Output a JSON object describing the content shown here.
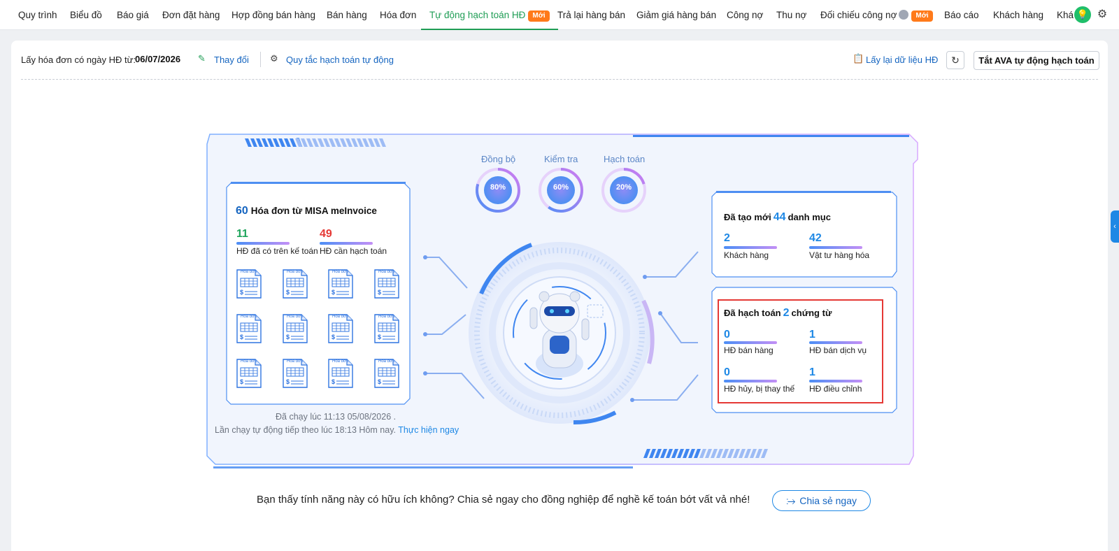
{
  "nav": {
    "items": [
      {
        "label": "Quy trình"
      },
      {
        "label": "Biểu đồ"
      },
      {
        "label": "Báo giá"
      },
      {
        "label": "Đơn đặt hàng"
      },
      {
        "label": "Hợp đồng bán hàng"
      },
      {
        "label": "Bán hàng"
      },
      {
        "label": "Hóa đơn"
      },
      {
        "label": "Tự động hạch toán HĐ",
        "badge": "Mới",
        "active": true
      },
      {
        "label": "Trả lại hàng bán"
      },
      {
        "label": "Giảm giá hàng bán"
      },
      {
        "label": "Công nợ"
      },
      {
        "label": "Thu nợ"
      },
      {
        "label": "Đối chiếu công nợ",
        "badge": "Mới"
      },
      {
        "label": "Báo cáo"
      },
      {
        "label": "Khách hàng"
      },
      {
        "label": "Khá"
      }
    ],
    "accent": "#1f9d55",
    "badge_color": "#ff7a1a"
  },
  "toolbar": {
    "date_label": "Lấy hóa đơn có ngày HĐ từ:",
    "date_value": "06/07/2026",
    "change_label": "Thay đổi",
    "rules_label": "Quy tắc hạch toán tự động",
    "reload_label": "Lấy lại dữ liệu HĐ",
    "toggle_ava_label": "Tắt AVA tự động hạch toán"
  },
  "stages": [
    {
      "label": "Đồng bộ",
      "percent_label": "80%",
      "percent": 80
    },
    {
      "label": "Kiểm tra",
      "percent_label": "60%",
      "percent": 60
    },
    {
      "label": "Hạch toán",
      "percent_label": "20%",
      "percent": 20
    }
  ],
  "invoices": {
    "total": "60",
    "title": "Hóa đơn từ MISA meInvoice",
    "in_books_count": "11",
    "in_books_label": "HĐ đã có trên kế toán",
    "to_post_count": "49",
    "to_post_label": "HĐ cần hạch toán",
    "doc_icon_label": "Hóa đơn"
  },
  "created": {
    "prefix": "Đã tạo mới",
    "count": "44",
    "suffix": "danh mục",
    "customers_count": "2",
    "customers_label": "Khách hàng",
    "items_count": "42",
    "items_label": "Vật tư hàng hóa"
  },
  "posted": {
    "prefix": "Đã hạch toán",
    "count": "2",
    "suffix": "chứng từ",
    "sales_count": "0",
    "sales_label": "HĐ bán hàng",
    "service_count": "1",
    "service_label": "HĐ bán dịch vụ",
    "cancelled_count": "0",
    "cancelled_label": "HĐ hủy, bị thay thế",
    "adjust_count": "1",
    "adjust_label": "HĐ điều chỉnh"
  },
  "run": {
    "last_run": "Đã chạy lúc 11:13 05/08/2026 .",
    "next_run": "Lần chạy tự động tiếp theo lúc 18:13 Hôm nay.",
    "run_now": "Thực hiện ngay"
  },
  "share": {
    "text": "Bạn thấy tính năng này có hữu ích không? Chia sẻ ngay cho đồng nghiệp để nghề kế toán bớt vất vả nhé!",
    "button": "Chia sẻ ngay"
  }
}
